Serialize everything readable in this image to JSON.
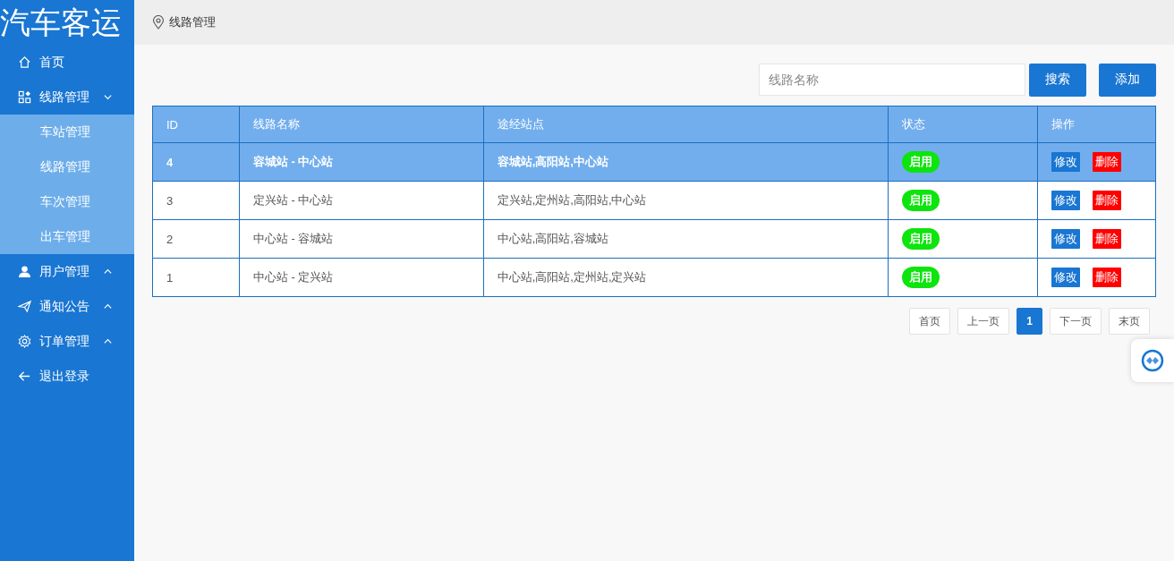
{
  "logo": "汽车客运",
  "breadcrumb": "线路管理",
  "menu": [
    {
      "label": "首页"
    },
    {
      "label": "线路管理",
      "expanded": true,
      "children": [
        {
          "label": "车站管理"
        },
        {
          "label": "线路管理"
        },
        {
          "label": "车次管理"
        },
        {
          "label": "出车管理"
        }
      ]
    },
    {
      "label": "用户管理",
      "expanded": false
    },
    {
      "label": "通知公告",
      "expanded": false
    },
    {
      "label": "订单管理",
      "expanded": false
    },
    {
      "label": "退出登录"
    }
  ],
  "search": {
    "placeholder": "线路名称"
  },
  "buttons": [
    "搜索",
    "添加"
  ],
  "table": {
    "columns": [
      "ID",
      "线路名称",
      "途经站点",
      "状态",
      "操作"
    ],
    "rows": [
      {
        "id": "4",
        "name": "容城站 - 中心站",
        "stations": "容城站,高阳站,中心站",
        "status": "启用",
        "edit": "修改",
        "delete": "删除",
        "selected": true
      },
      {
        "id": "3",
        "name": "定兴站 - 中心站",
        "stations": "定兴站,定州站,高阳站,中心站",
        "status": "启用",
        "edit": "修改",
        "delete": "删除",
        "selected": false
      },
      {
        "id": "2",
        "name": "中心站 - 容城站",
        "stations": "中心站,高阳站,容城站",
        "status": "启用",
        "edit": "修改",
        "delete": "删除",
        "selected": false
      },
      {
        "id": "1",
        "name": "中心站 - 定兴站",
        "stations": "中心站,高阳站,定州站,定兴站",
        "status": "启用",
        "edit": "修改",
        "delete": "删除",
        "selected": false
      }
    ]
  },
  "pagination": [
    {
      "label": "首页",
      "selected": false
    },
    {
      "label": "上一页",
      "selected": false
    },
    {
      "label": "1",
      "selected": true
    },
    {
      "label": "下一页",
      "selected": false
    },
    {
      "label": "末页",
      "selected": false
    }
  ]
}
